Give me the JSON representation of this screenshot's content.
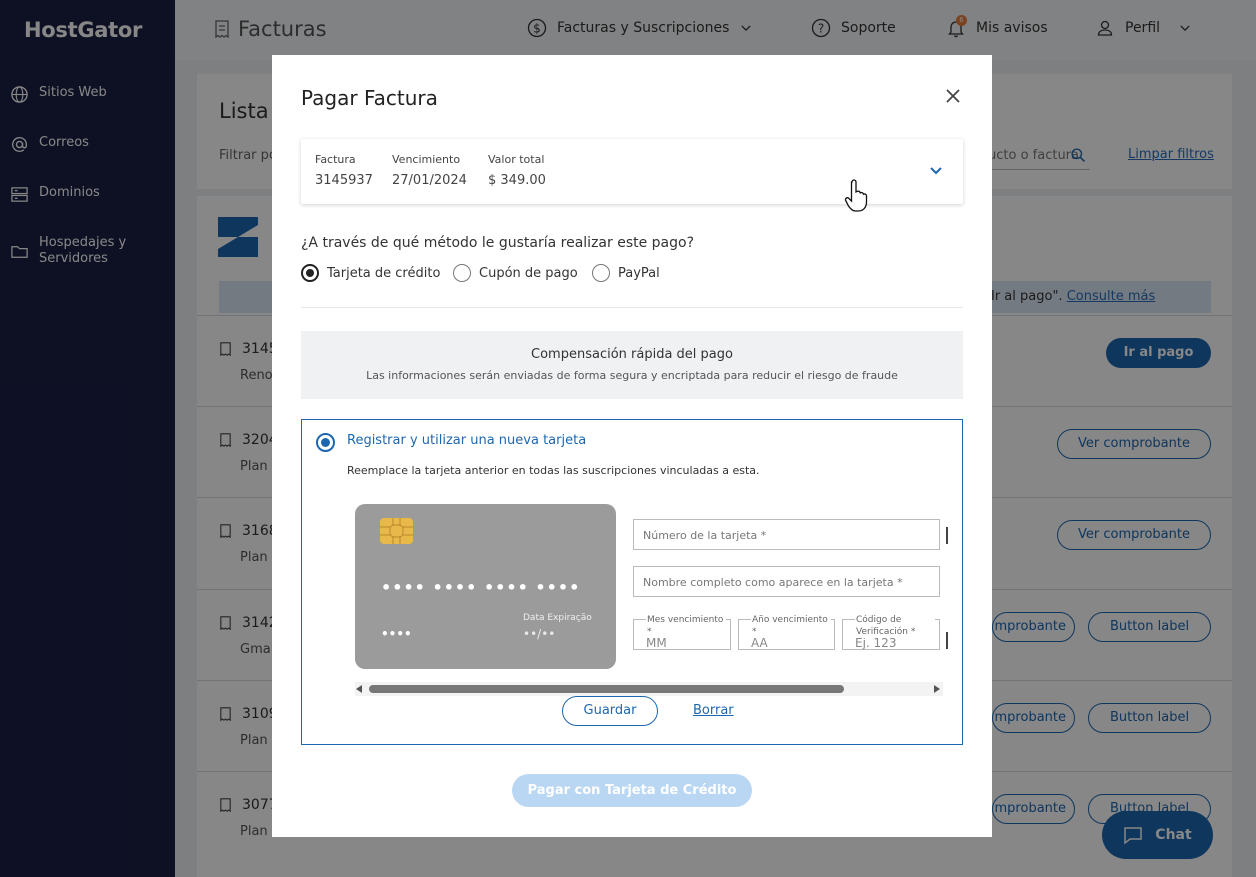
{
  "brand": {
    "logo_text": "HostGator"
  },
  "sidebar": {
    "items": [
      {
        "label": "Sitios Web",
        "icon": "globe-icon"
      },
      {
        "label": "Correos",
        "icon": "at-icon"
      },
      {
        "label": "Dominios",
        "icon": "server-icon"
      },
      {
        "label": "Hospedajes y Servidores",
        "icon": "folder-icon"
      }
    ]
  },
  "header": {
    "page_title": "Facturas",
    "invoices_menu": "Facturas y Suscripciones",
    "support": "Soporte",
    "notices": "Mis avisos",
    "notices_count": "6",
    "profile": "Perfil"
  },
  "background": {
    "list_title": "Lista",
    "filter_label": "Filtrar po",
    "search_placeholder": "ucto o factura",
    "clear_filters": "Limpar filtros",
    "info_text": "Ir al pago\".",
    "info_link": "Consulte más",
    "rows": [
      {
        "number": "3145",
        "sub": "Reno",
        "actions": [
          "Ir al pago"
        ]
      },
      {
        "number": "3204",
        "sub": "Plan I",
        "actions": [
          "Ver comprobante"
        ]
      },
      {
        "number": "3168",
        "sub": "Plan I",
        "actions": [
          "Ver comprobante"
        ]
      },
      {
        "number": "3142",
        "sub": "Gmai",
        "actions": [
          "mprobante",
          "Button label"
        ]
      },
      {
        "number": "3109",
        "sub": "Plan I",
        "actions": [
          "mprobante",
          "Button label"
        ]
      },
      {
        "number": "3077",
        "sub": "Plan",
        "actions": [
          "mprobante",
          "Button label"
        ]
      }
    ]
  },
  "modal": {
    "title": "Pagar Factura",
    "invoice": {
      "col1_label": "Factura",
      "col1_value": "3145937",
      "col2_label": "Vencimiento",
      "col2_value": "27/01/2024",
      "col3_label": "Valor total",
      "col3_value": "$ 349.00"
    },
    "method_question": "¿A través de qué método le gustaría realizar este pago?",
    "methods": [
      {
        "label": "Tarjeta de crédito",
        "selected": true
      },
      {
        "label": "Cupón de pago",
        "selected": false
      },
      {
        "label": "PayPal",
        "selected": false
      }
    ],
    "fast_title": "Compensación rápida del pago",
    "fast_subtitle": "Las informaciones serán enviadas de forma segura y encriptada para reducir el riesgo de fraude",
    "card_option": "Registrar y utilizar una nueva tarjeta",
    "card_note": "Reemplace la tarjeta anterior en todas las suscripciones vinculadas a esta.",
    "card_preview": {
      "number_mask": "•••• •••• •••• ••••",
      "name_mask": "••••",
      "expiry_label": "Data Expiração",
      "expiry_mask": "••/••"
    },
    "fields": {
      "card_number_placeholder": "Número de la tarjeta *",
      "card_name_placeholder": "Nombre completo como aparece en la tarjeta *",
      "month_label": "Mes vencimiento *",
      "month_placeholder": "MM",
      "year_label": "Año vencimiento *",
      "year_placeholder": "AA",
      "cvv_label": "Código de Verificación *",
      "cvv_placeholder": "Ej. 123"
    },
    "save_label": "Guardar",
    "delete_label": "Borrar",
    "pay_label": "Pagar con Tarjeta de Crédito"
  },
  "chat": {
    "label": "Chat"
  },
  "colors": {
    "sidebar_bg": "#1b1f45",
    "accent": "#1d67b0",
    "pay_disabled": "#b9d7f3"
  }
}
